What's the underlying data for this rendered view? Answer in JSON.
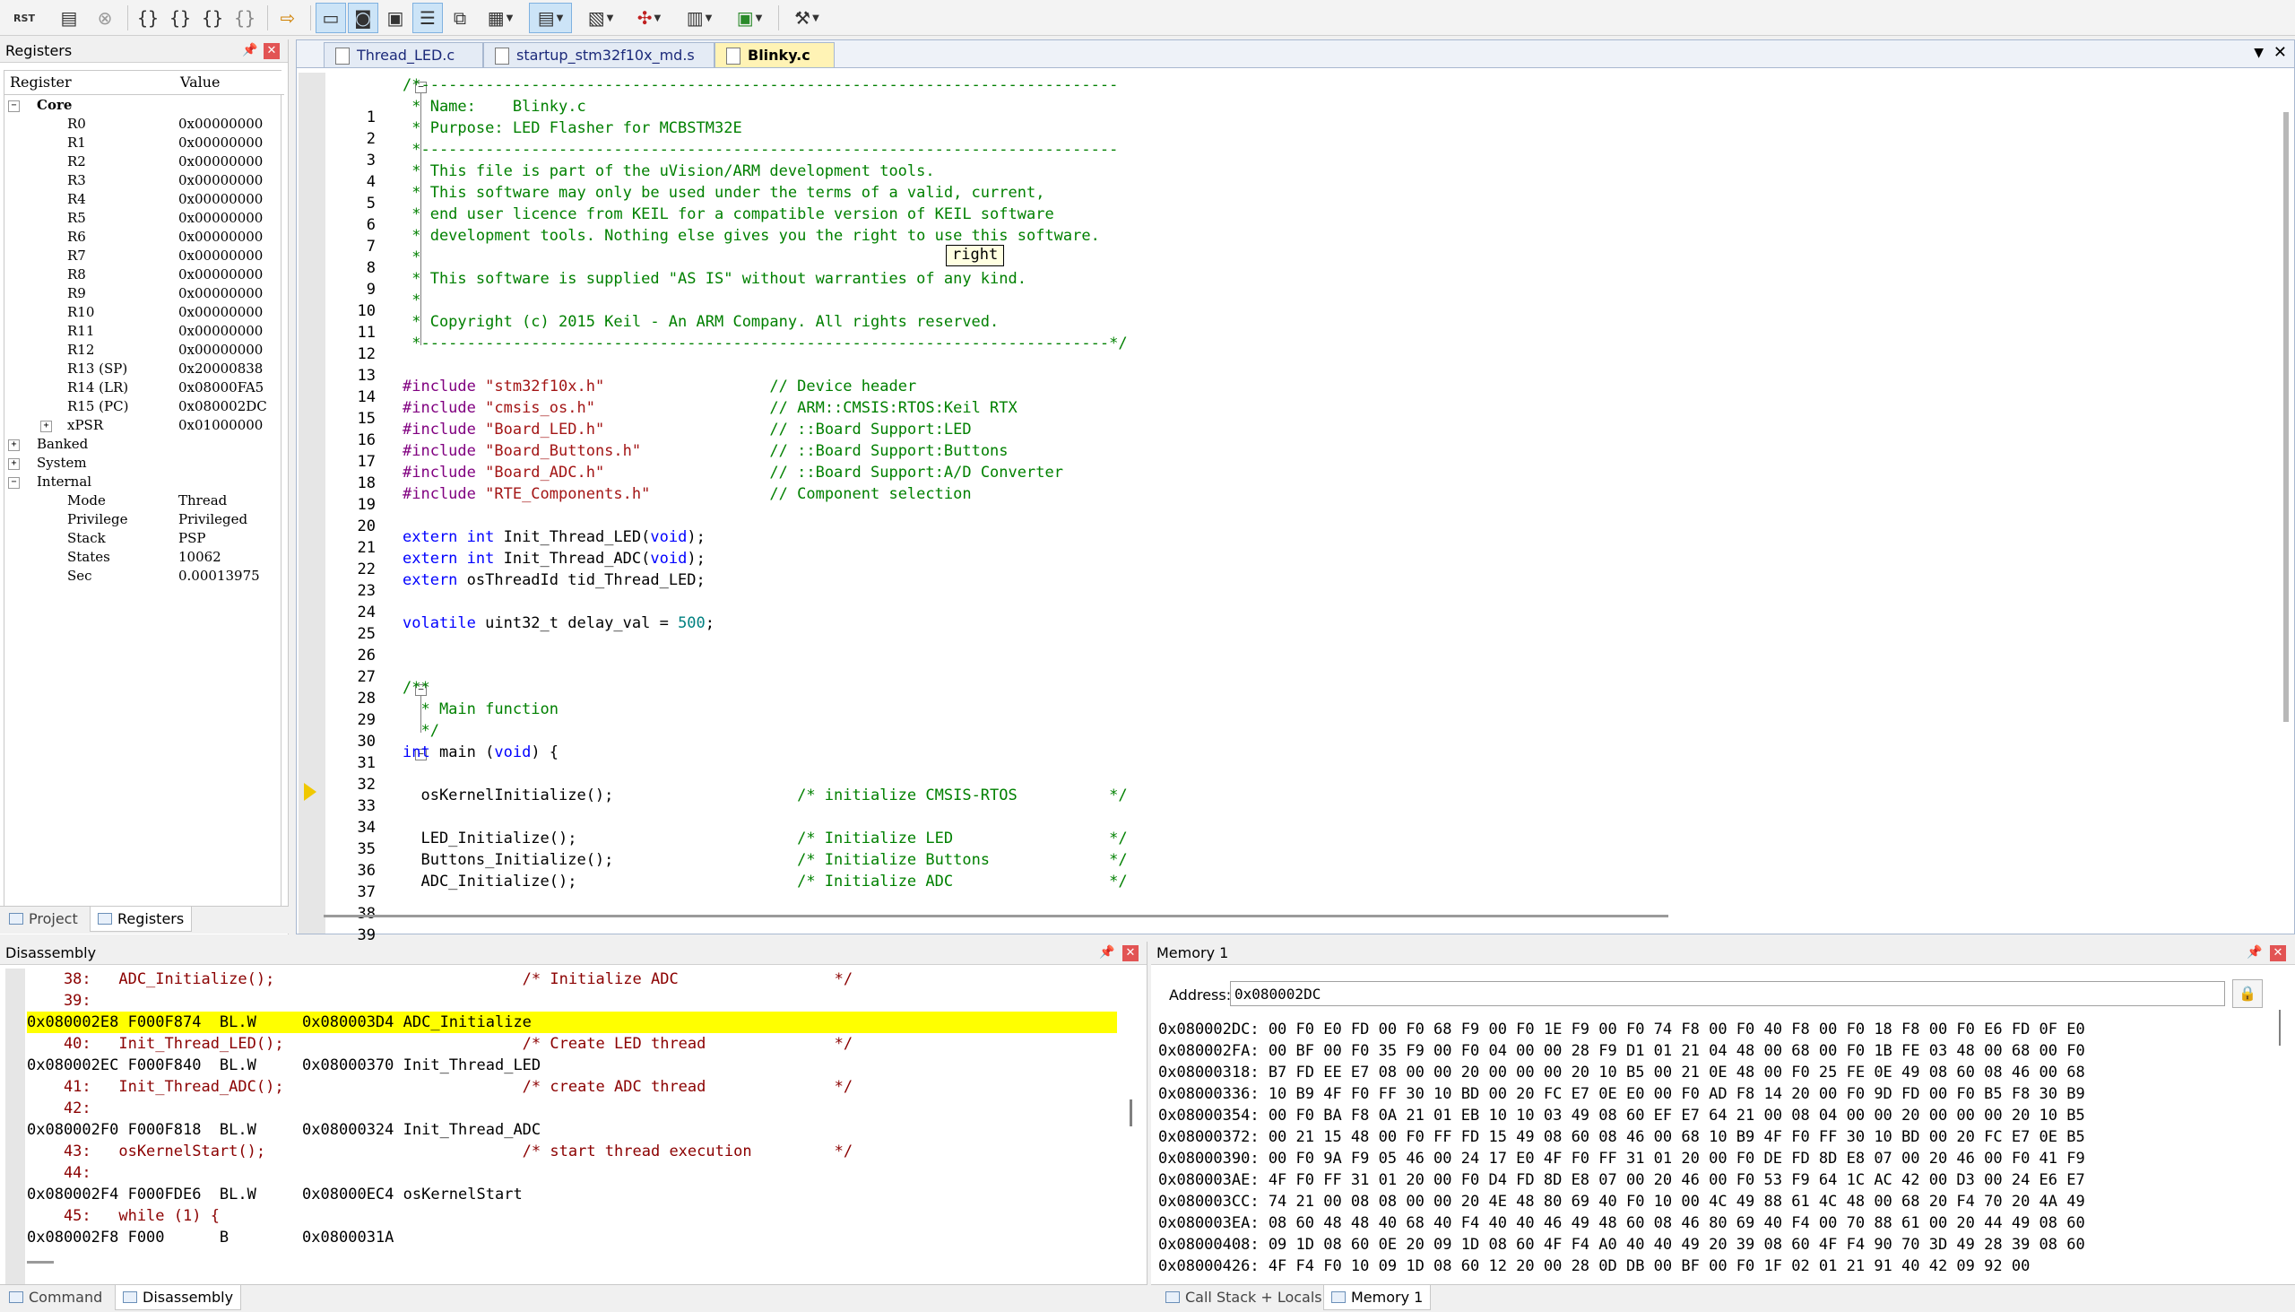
{
  "toolbar": {
    "rst_label": "RST",
    "buttons": [
      {
        "name": "reset-icon"
      },
      {
        "name": "run-icon"
      },
      {
        "name": "stop-icon"
      },
      {
        "name": "step-icon"
      },
      {
        "name": "step-over-icon"
      },
      {
        "name": "step-out-icon"
      },
      {
        "name": "run-to-cursor-icon"
      },
      {
        "name": "show-next-statement-icon"
      },
      {
        "name": "command-window-icon"
      },
      {
        "name": "disassembly-window-icon"
      },
      {
        "name": "symbols-window-icon"
      },
      {
        "name": "registers-window-icon"
      },
      {
        "name": "call-stack-icon"
      },
      {
        "name": "watch-window-icon"
      },
      {
        "name": "memory-window-icon"
      },
      {
        "name": "serial-window-icon"
      },
      {
        "name": "analysis-window-icon"
      },
      {
        "name": "trace-window-icon"
      },
      {
        "name": "system-viewer-icon"
      },
      {
        "name": "toolbox-icon"
      }
    ]
  },
  "registers": {
    "title": "Registers",
    "col_register": "Register",
    "col_value": "Value",
    "rows": [
      {
        "name": "Core",
        "value": "",
        "level": 0,
        "toggle": "−",
        "bold": true
      },
      {
        "name": "R0",
        "value": "0x00000000",
        "level": 2
      },
      {
        "name": "R1",
        "value": "0x00000000",
        "level": 2
      },
      {
        "name": "R2",
        "value": "0x00000000",
        "level": 2
      },
      {
        "name": "R3",
        "value": "0x00000000",
        "level": 2
      },
      {
        "name": "R4",
        "value": "0x00000000",
        "level": 2
      },
      {
        "name": "R5",
        "value": "0x00000000",
        "level": 2
      },
      {
        "name": "R6",
        "value": "0x00000000",
        "level": 2
      },
      {
        "name": "R7",
        "value": "0x00000000",
        "level": 2
      },
      {
        "name": "R8",
        "value": "0x00000000",
        "level": 2
      },
      {
        "name": "R9",
        "value": "0x00000000",
        "level": 2
      },
      {
        "name": "R10",
        "value": "0x00000000",
        "level": 2
      },
      {
        "name": "R11",
        "value": "0x00000000",
        "level": 2
      },
      {
        "name": "R12",
        "value": "0x00000000",
        "level": 2
      },
      {
        "name": "R13 (SP)",
        "value": "0x20000838",
        "level": 2
      },
      {
        "name": "R14 (LR)",
        "value": "0x08000FA5",
        "level": 2
      },
      {
        "name": "R15 (PC)",
        "value": "0x080002DC",
        "level": 2
      },
      {
        "name": "xPSR",
        "value": "0x01000000",
        "level": 1,
        "toggle": "+"
      },
      {
        "name": "Banked",
        "value": "",
        "level": 0,
        "toggle": "+"
      },
      {
        "name": "System",
        "value": "",
        "level": 0,
        "toggle": "+"
      },
      {
        "name": "Internal",
        "value": "",
        "level": 0,
        "toggle": "−"
      },
      {
        "name": "Mode",
        "value": "Thread",
        "level": 2
      },
      {
        "name": "Privilege",
        "value": "Privileged",
        "level": 2
      },
      {
        "name": "Stack",
        "value": "PSP",
        "level": 2
      },
      {
        "name": "States",
        "value": "10062",
        "level": 2
      },
      {
        "name": "Sec",
        "value": "0.00013975",
        "level": 2
      }
    ],
    "tabs": [
      {
        "label": "Project"
      },
      {
        "label": "Registers"
      }
    ]
  },
  "editor": {
    "tabs": [
      {
        "label": "Thread_LED.c"
      },
      {
        "label": "startup_stm32f10x_md.s"
      },
      {
        "label": "Blinky.c"
      }
    ],
    "tooltip": "right",
    "lines": [
      {
        "n": "1",
        "segs": [
          {
            "t": "/*----------------------------------------------------------------------------",
            "c": "cm"
          }
        ]
      },
      {
        "n": "2",
        "segs": [
          {
            "t": " * Name:    Blinky.c",
            "c": "cm"
          }
        ]
      },
      {
        "n": "3",
        "segs": [
          {
            "t": " * Purpose: LED Flasher for MCBSTM32E",
            "c": "cm"
          }
        ]
      },
      {
        "n": "4",
        "segs": [
          {
            "t": " *----------------------------------------------------------------------------",
            "c": "cm"
          }
        ]
      },
      {
        "n": "5",
        "segs": [
          {
            "t": " * This file is part of the uVision/ARM development tools.",
            "c": "cm"
          }
        ]
      },
      {
        "n": "6",
        "segs": [
          {
            "t": " * This software may only be used under the terms of a valid, current,",
            "c": "cm"
          }
        ]
      },
      {
        "n": "7",
        "segs": [
          {
            "t": " * end user licence from KEIL for a compatible version of KEIL software",
            "c": "cm"
          }
        ]
      },
      {
        "n": "8",
        "segs": [
          {
            "t": " * development tools. Nothing else gives you the right to use this software.",
            "c": "cm"
          }
        ]
      },
      {
        "n": "9",
        "segs": [
          {
            "t": " *",
            "c": "cm"
          }
        ]
      },
      {
        "n": "10",
        "segs": [
          {
            "t": " * This software is supplied \"AS IS\" without warranties of any kind.",
            "c": "cm"
          }
        ]
      },
      {
        "n": "11",
        "segs": [
          {
            "t": " *",
            "c": "cm"
          }
        ]
      },
      {
        "n": "12",
        "segs": [
          {
            "t": " * Copyright (c) 2015 Keil - An ARM Company. All rights reserved.",
            "c": "cm"
          }
        ]
      },
      {
        "n": "13",
        "segs": [
          {
            "t": " *---------------------------------------------------------------------------*/",
            "c": "cm"
          }
        ]
      },
      {
        "n": "14",
        "segs": []
      },
      {
        "n": "15",
        "segs": [
          {
            "t": "#include ",
            "c": "pp"
          },
          {
            "t": "\"stm32f10x.h\"",
            "c": "str"
          },
          {
            "t": "                  // Device header",
            "c": "cm"
          }
        ]
      },
      {
        "n": "16",
        "segs": [
          {
            "t": "#include ",
            "c": "pp"
          },
          {
            "t": "\"cmsis_os.h\"",
            "c": "str"
          },
          {
            "t": "                   // ARM::CMSIS:RTOS:Keil RTX",
            "c": "cm"
          }
        ]
      },
      {
        "n": "17",
        "segs": [
          {
            "t": "#include ",
            "c": "pp"
          },
          {
            "t": "\"Board_LED.h\"",
            "c": "str"
          },
          {
            "t": "                  // ::Board Support:LED",
            "c": "cm"
          }
        ]
      },
      {
        "n": "18",
        "segs": [
          {
            "t": "#include ",
            "c": "pp"
          },
          {
            "t": "\"Board_Buttons.h\"",
            "c": "str"
          },
          {
            "t": "              // ::Board Support:Buttons",
            "c": "cm"
          }
        ]
      },
      {
        "n": "19",
        "segs": [
          {
            "t": "#include ",
            "c": "pp"
          },
          {
            "t": "\"Board_ADC.h\"",
            "c": "str"
          },
          {
            "t": "                  // ::Board Support:A/D Converter",
            "c": "cm"
          }
        ]
      },
      {
        "n": "20",
        "segs": [
          {
            "t": "#include ",
            "c": "pp"
          },
          {
            "t": "\"RTE_Components.h\"",
            "c": "str"
          },
          {
            "t": "             // Component selection",
            "c": "cm"
          }
        ]
      },
      {
        "n": "21",
        "segs": []
      },
      {
        "n": "22",
        "segs": [
          {
            "t": "extern ",
            "c": "kw"
          },
          {
            "t": "int",
            "c": "kw"
          },
          {
            "t": " Init_Thread_LED(",
            "c": "df"
          },
          {
            "t": "void",
            "c": "kw"
          },
          {
            "t": ");",
            "c": "df"
          }
        ]
      },
      {
        "n": "23",
        "segs": [
          {
            "t": "extern ",
            "c": "kw"
          },
          {
            "t": "int",
            "c": "kw"
          },
          {
            "t": " Init_Thread_ADC(",
            "c": "df"
          },
          {
            "t": "void",
            "c": "kw"
          },
          {
            "t": ");",
            "c": "df"
          }
        ]
      },
      {
        "n": "24",
        "segs": [
          {
            "t": "extern ",
            "c": "kw"
          },
          {
            "t": "osThreadId tid_Thread_LED;",
            "c": "df"
          }
        ]
      },
      {
        "n": "25",
        "segs": []
      },
      {
        "n": "26",
        "segs": [
          {
            "t": "volatile ",
            "c": "kw"
          },
          {
            "t": "uint32_t delay_val = ",
            "c": "df"
          },
          {
            "t": "500",
            "c": "num"
          },
          {
            "t": ";",
            "c": "df"
          }
        ]
      },
      {
        "n": "27",
        "segs": []
      },
      {
        "n": "28",
        "segs": []
      },
      {
        "n": "29",
        "segs": [
          {
            "t": "/**",
            "c": "cm"
          }
        ]
      },
      {
        "n": "30",
        "segs": [
          {
            "t": "  * Main function",
            "c": "cm"
          }
        ]
      },
      {
        "n": "31",
        "segs": [
          {
            "t": "  */",
            "c": "cm"
          }
        ]
      },
      {
        "n": "32",
        "segs": [
          {
            "t": "int",
            "c": "kw"
          },
          {
            "t": " main (",
            "c": "df"
          },
          {
            "t": "void",
            "c": "kw"
          },
          {
            "t": ") {",
            "c": "df"
          }
        ]
      },
      {
        "n": "33",
        "segs": []
      },
      {
        "n": "34",
        "segs": [
          {
            "t": "  osKernelInitialize();",
            "c": "df"
          },
          {
            "t": "                    /* initialize CMSIS-RTOS          */",
            "c": "cm"
          }
        ]
      },
      {
        "n": "35",
        "segs": []
      },
      {
        "n": "36",
        "segs": [
          {
            "t": "  LED_Initialize();",
            "c": "df"
          },
          {
            "t": "                        /* Initialize LED                 */",
            "c": "cm"
          }
        ]
      },
      {
        "n": "37",
        "segs": [
          {
            "t": "  Buttons_Initialize();",
            "c": "df"
          },
          {
            "t": "                    /* Initialize Buttons             */",
            "c": "cm"
          }
        ]
      },
      {
        "n": "38",
        "segs": [
          {
            "t": "  ADC_Initialize();",
            "c": "df"
          },
          {
            "t": "                        /* Initialize ADC                 */",
            "c": "cm"
          }
        ]
      },
      {
        "n": "39",
        "segs": []
      }
    ]
  },
  "disassembly": {
    "title": "Disassembly",
    "lines": [
      {
        "t": "    38:   ADC_Initialize();                           /* Initialize ADC                 */",
        "k": "src"
      },
      {
        "t": "    39: ",
        "k": "src"
      },
      {
        "t": "0x080002E8 F000F874  BL.W     0x080003D4 ADC_Initialize",
        "k": "hl"
      },
      {
        "t": "    40:   Init_Thread_LED();                          /* Create LED thread              */",
        "k": "src"
      },
      {
        "t": "0x080002EC F000F840  BL.W     0x08000370 Init_Thread_LED",
        "k": "asm"
      },
      {
        "t": "    41:   Init_Thread_ADC();                          /* create ADC thread              */",
        "k": "src"
      },
      {
        "t": "    42: ",
        "k": "src"
      },
      {
        "t": "0x080002F0 F000F818  BL.W     0x08000324 Init_Thread_ADC",
        "k": "asm"
      },
      {
        "t": "    43:   osKernelStart();                            /* start thread execution         */",
        "k": "src"
      },
      {
        "t": "    44: ",
        "k": "src"
      },
      {
        "t": "0x080002F4 F000FDE6  BL.W     0x08000EC4 osKernelStart",
        "k": "asm"
      },
      {
        "t": "    45:   while (1) {",
        "k": "src"
      },
      {
        "t": "0x080002F8 F000      B        0x0800031A",
        "k": "asm"
      }
    ],
    "tabs": [
      {
        "label": "Command"
      },
      {
        "label": "Disassembly"
      }
    ]
  },
  "memory": {
    "title": "Memory 1",
    "address_label": "Address:",
    "address_value": "0x080002DC",
    "lines": [
      "0x080002DC: 00 F0 E0 FD 00 F0 68 F9 00 F0 1E F9 00 F0 74 F8 00 F0 40 F8 00 F0 18 F8 00 F0 E6 FD 0F E0",
      "0x080002FA: 00 BF 00 F0 35 F9 00 F0 04 00 00 28 F9 D1 01 21 04 48 00 68 00 F0 1B FE 03 48 00 68 00 F0",
      "0x08000318: B7 FD EE E7 08 00 00 20 00 00 00 20 10 B5 00 21 0E 48 00 F0 25 FE 0E 49 08 60 08 46 00 68",
      "0x08000336: 10 B9 4F F0 FF 30 10 BD 00 20 FC E7 0E E0 00 F0 AD F8 14 20 00 F0 9D FD 00 F0 B5 F8 30 B9",
      "0x08000354: 00 F0 BA F8 0A 21 01 EB 10 10 03 49 08 60 EF E7 64 21 00 08 04 00 00 20 00 00 00 20 10 B5",
      "0x08000372: 00 21 15 48 00 F0 FF FD 15 49 08 60 08 46 00 68 10 B9 4F F0 FF 30 10 BD 00 20 FC E7 0E B5",
      "0x08000390: 00 F0 9A F9 05 46 00 24 17 E0 4F F0 FF 31 01 20 00 F0 DE FD 8D E8 07 00 20 46 00 F0 41 F9",
      "0x080003AE: 4F F0 FF 31 01 20 00 F0 D4 FD 8D E8 07 00 20 46 00 F0 53 F9 64 1C AC 42 00 D3 00 24 E6 E7",
      "0x080003CC: 74 21 00 08 08 00 00 20 4E 48 80 69 40 F0 10 00 4C 49 88 61 4C 48 00 68 20 F4 70 20 4A 49",
      "0x080003EA: 08 60 48 48 40 68 40 F4 40 40 46 49 48 60 08 46 80 69 40 F4 00 70 88 61 00 20 44 49 08 60",
      "0x08000408: 09 1D 08 60 0E 20 09 1D 08 60 4F F4 A0 40 40 49 20 39 08 60 4F F4 90 70 3D 49 28 39 08 60",
      "0x08000426: 4F F4 F0 10 09 1D 08 60 12 20 00 28 0D DB 00 BF 00 F0 1F 02 01 21 91 40 42 09 92 00"
    ],
    "tabs": [
      {
        "label": "Call Stack + Locals"
      },
      {
        "label": "Memory 1"
      }
    ]
  }
}
